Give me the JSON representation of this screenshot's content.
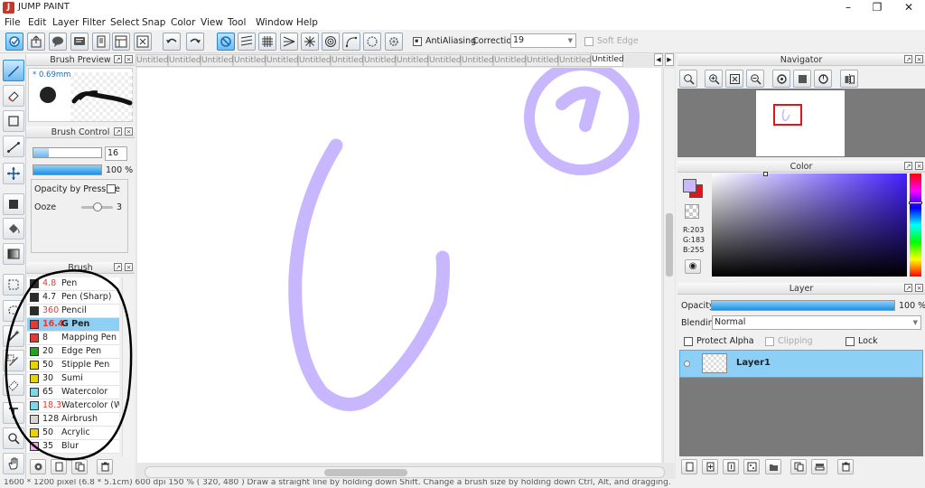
{
  "app": {
    "title": "JUMP PAINT"
  },
  "menu": [
    "File",
    "Edit",
    "Layer",
    "Filter",
    "Select",
    "Snap",
    "Color",
    "View",
    "Tool",
    "Window",
    "Help"
  ],
  "toolbar": {
    "antialias_label": "AntiAliasing",
    "correction_label": "Correction",
    "correction_value": "19",
    "soft_edge_label": "Soft Edge"
  },
  "tabs": {
    "labels": [
      "Untitled",
      "Untitled",
      "Untitled",
      "Untitled",
      "Untitled",
      "Untitled",
      "Untitled",
      "Untitled",
      "Untitled",
      "Untitled",
      "Untitled",
      "Untitled",
      "Untitled",
      "Untitled",
      "Untitled"
    ]
  },
  "brush_preview": {
    "title": "Brush Preview",
    "size_label": "* 0.69mm"
  },
  "brush_control": {
    "title": "Brush Control",
    "size_value": "16",
    "opacity_value": "100 %",
    "opacity_by_pressure_label": "Opacity by Pressure",
    "ooze_label": "Ooze",
    "ooze_value": "3",
    "size_fill": 0.22,
    "opacity_fill": 1.0,
    "ooze_level": 0.5
  },
  "brush": {
    "title": "Brush",
    "items": [
      {
        "size": "4.8",
        "name": "Pen",
        "color": "#2b2b2b",
        "size_color": "#e53935"
      },
      {
        "size": "4.7",
        "name": "Pen (Sharp)",
        "color": "#2b2b2b",
        "size_color": "#222222"
      },
      {
        "size": "360",
        "name": "Pencil",
        "color": "#2b2b2b",
        "size_color": "#e53935"
      },
      {
        "size": "16.4",
        "name": "G Pen",
        "color": "#e53935",
        "size_color": "#e53935",
        "selected": true
      },
      {
        "size": "8",
        "name": "Mapping Pen",
        "color": "#e53935",
        "size_color": "#222222"
      },
      {
        "size": "20",
        "name": "Edge Pen",
        "color": "#22a322",
        "size_color": "#222222"
      },
      {
        "size": "50",
        "name": "Stipple Pen",
        "color": "#e8d400",
        "size_color": "#222222"
      },
      {
        "size": "30",
        "name": "Sumi",
        "color": "#e8d400",
        "size_color": "#222222"
      },
      {
        "size": "65",
        "name": "Watercolor",
        "color": "#7fd6e8",
        "size_color": "#222222"
      },
      {
        "size": "18.3",
        "name": "Watercolor (We",
        "color": "#7fd6e8",
        "size_color": "#e53935"
      },
      {
        "size": "128",
        "name": "Airbrush",
        "color": "#d6d6d6",
        "size_color": "#222222"
      },
      {
        "size": "50",
        "name": "Acrylic",
        "color": "#e8d400",
        "size_color": "#222222"
      },
      {
        "size": "35",
        "name": "Blur",
        "color": "#f6a8ee",
        "size_color": "#222222"
      }
    ]
  },
  "navigator": {
    "title": "Navigator"
  },
  "color": {
    "title": "Color",
    "r_label": "R:203",
    "g_label": "G:183",
    "b_label": "B:255",
    "foreground": "#cbb7ff",
    "background": "#e5141b"
  },
  "layer": {
    "title": "Layer",
    "opacity_label": "Opacity",
    "opacity_value": "100 %",
    "blending_label": "Blending",
    "blending_value": "Normal",
    "protect_alpha_label": "Protect Alpha",
    "clipping_label": "Clipping",
    "lock_label": "Lock",
    "layers": [
      {
        "name": "Layer1"
      }
    ]
  },
  "status": {
    "text": "1600 * 1200 pixel   (6.8 * 5.1cm)   600 dpi   150 %   ( 320, 480 )   Draw a straight line by holding down Shift. Change a brush size by holding down Ctrl, Alt, and dragging."
  },
  "colors": {
    "accent": "#2c86d1",
    "selection": "#8ecff5",
    "stroke": "#c8b7ff",
    "annotation": "#000000"
  }
}
